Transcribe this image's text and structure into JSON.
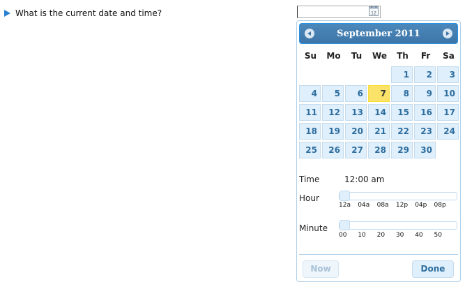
{
  "question": "What is the current date and time?",
  "input": {
    "value": ""
  },
  "picker": {
    "month_title": "September 2011",
    "weekdays": [
      "Su",
      "Mo",
      "Tu",
      "We",
      "Th",
      "Fr",
      "Sa"
    ],
    "weeks": [
      [
        "",
        "",
        "",
        "",
        "1",
        "2",
        "3"
      ],
      [
        "4",
        "5",
        "6",
        "7",
        "8",
        "9",
        "10"
      ],
      [
        "11",
        "12",
        "13",
        "14",
        "15",
        "16",
        "17"
      ],
      [
        "18",
        "19",
        "20",
        "21",
        "22",
        "23",
        "24"
      ],
      [
        "25",
        "26",
        "27",
        "28",
        "29",
        "30",
        ""
      ]
    ],
    "highlighted_day": "7",
    "time_label": "Time",
    "time_value": "12:00 am",
    "hour_label": "Hour",
    "hour_ticks": [
      "12a",
      "04a",
      "08a",
      "12p",
      "04p",
      "08p"
    ],
    "hour_level": 0,
    "minute_label": "Minute",
    "minute_ticks": [
      "00",
      "10",
      "20",
      "30",
      "40",
      "50"
    ],
    "minute_level": 0,
    "now_label": "Now",
    "done_label": "Done"
  },
  "colors": {
    "accent": "#3d75a8",
    "today": "#fbe36a",
    "day_cell": "#dfeffc"
  },
  "icons": {
    "question_marker": "play-arrow-icon",
    "calendar": "calendar-icon",
    "prev": "circle-arrow-left-icon",
    "next": "circle-arrow-right-icon"
  }
}
